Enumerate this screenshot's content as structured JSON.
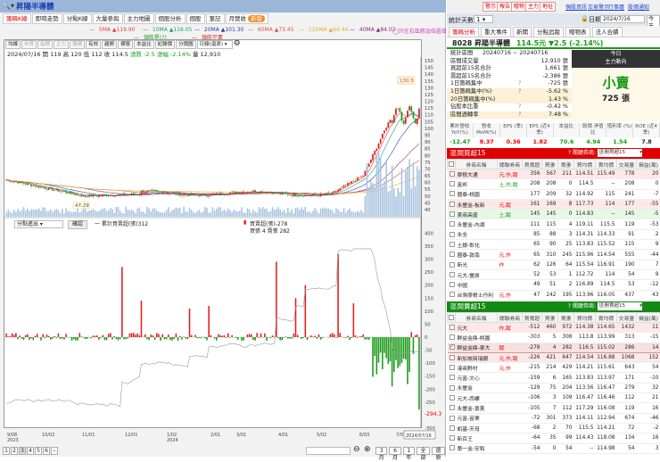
{
  "window": {
    "title": "昇陽半導體",
    "search_icon": "search-icon"
  },
  "tabs": [
    {
      "label": "籌碼K線",
      "active": true
    },
    {
      "label": "即時走勢"
    },
    {
      "label": "分點K線"
    },
    {
      "label": "大量參與"
    },
    {
      "label": "主力地圖"
    },
    {
      "label": "個股分析"
    },
    {
      "label": "個股"
    },
    {
      "label": "筆記"
    },
    {
      "label": "月營收",
      "badge": "新版"
    }
  ],
  "ma_legend": [
    {
      "label": "5MA ▲119.90",
      "color": "#e04040"
    },
    {
      "label": "10MA ▲116.05",
      "color": "#20a080"
    },
    {
      "label": "20MA ▲101.30",
      "color": "#3040a0"
    },
    {
      "label": "60MA ▲73.45",
      "color": "#e05050"
    },
    {
      "label": "120MA ▲64.44",
      "color": "#e0b030"
    },
    {
      "label": "40MA ▲84.02",
      "color": "#803080"
    },
    {
      "label": "領航星(?)",
      "color": "#20a020"
    },
    {
      "label": "領航空軍",
      "color": "#e02020"
    }
  ],
  "ma_note": "◯只在右區將加倍遞增",
  "toolbar": {
    "buttons": [
      {
        "label": "均線",
        "dis": false
      },
      {
        "label": "布買",
        "dis": true
      },
      {
        "label": "指標",
        "dis": true
      },
      {
        "label": "主力",
        "dis": true
      },
      {
        "label": "籌碼",
        "dis": true
      },
      {
        "label": "有效",
        "dis": false
      },
      {
        "label": "趨勢",
        "dis": false
      },
      {
        "label": "標靈",
        "dis": false
      },
      {
        "label": "本益比",
        "dis": false
      },
      {
        "label": "紀錄價",
        "dis": false
      },
      {
        "label": "分價圖",
        "dis": false
      }
    ],
    "period": "日線(還原)"
  },
  "info_line": {
    "date": "2024/07/16",
    "open": "開 119",
    "high": "高 120",
    "low": "低 112",
    "close": "收 114.5",
    "change": "漲跌 -2.5",
    "pct": "漲幅 -2.14%",
    "volume": "量 12,910"
  },
  "price_chart": {
    "y_ticks": [
      150,
      145,
      140,
      135,
      130,
      125,
      120,
      115,
      110,
      105,
      100,
      95,
      90,
      85,
      80,
      75,
      70,
      65,
      60,
      55,
      50,
      45,
      40
    ],
    "max_label": "130.5",
    "min_label": "47.29"
  },
  "lower_panel": {
    "select": "分點進出",
    "confirm": "確認",
    "cum_label": "一 累計買賣超(張)312",
    "net_label": "買賣超(張)-278",
    "buysell_label": "買張 4 賣張 282",
    "y_ticks": [
      400,
      350,
      300,
      250,
      200,
      150,
      100,
      50,
      0,
      -50,
      -100,
      -150,
      -200,
      -250,
      -350
    ],
    "last_value": "-294.3"
  },
  "x_axis": [
    {
      "label": "9/08",
      "sub": "2023"
    },
    {
      "label": "10/02"
    },
    {
      "label": "11/01"
    },
    {
      "label": "12/01"
    },
    {
      "label": "1/02",
      "sub": "2024"
    },
    {
      "label": "2/01"
    },
    {
      "label": "3/01"
    },
    {
      "label": "4/01"
    },
    {
      "label": "5/02"
    },
    {
      "label": "6/03"
    },
    {
      "label": "7/01"
    }
  ],
  "x_current": "2024/07/16",
  "pager": [
    "1",
    "2",
    "3",
    "4",
    "5",
    "6"
  ],
  "range_buttons": [
    "3月",
    "6月",
    "1年",
    "全部",
    "還原"
  ],
  "right": {
    "buttons": [
      "警示",
      "報告",
      "贈物",
      "主力",
      "地址"
    ],
    "links": [
      "個股資訊",
      "交易警示",
      "行事曆",
      "股價通知"
    ],
    "days_label": "統計天數",
    "days_value": "1",
    "date_label": "日期",
    "date_value": "2024/7/16",
    "today": "今天",
    "tabs": [
      "籌碼分析",
      "重大事件",
      "新聞",
      "分點追蹤",
      "贈物表",
      "法人合績"
    ],
    "stock": {
      "code": "8028 昇陽半導體",
      "price": "114.5元",
      "change": "▼2.5 (-2.14%)"
    },
    "stats": [
      {
        "k": "統計區間",
        "v": "20240716 ~ 20240716",
        "y": false
      },
      {
        "k": "區間成交量",
        "v": "12,910 張"
      },
      {
        "k": "買超前15名合計",
        "v": "1,661 張"
      },
      {
        "k": "賣超前15名合計",
        "v": "-2,386 張"
      },
      {
        "k": "1日籌碼集中",
        "v": "-725 張",
        "q": "?"
      },
      {
        "k": "1日籌碼集中(%)",
        "v": "-5.62 %",
        "q": "?",
        "y": true
      },
      {
        "k": "20日籌碼集中(%)",
        "v": "1.43 %",
        "y": true
      },
      {
        "k": "佔股本比重",
        "v": "-0.42 %",
        "q": "?"
      },
      {
        "k": "區間週轉率",
        "v": "7.48 %",
        "q": "?",
        "y": true
      }
    ],
    "today_label": "今日",
    "trend_label": "主力動向",
    "signal": "小賣",
    "signal_qty": "725 張",
    "metrics": [
      {
        "h": "累計營收 YoY(%)",
        "v": "-12.47",
        "c": "#1a9a1a"
      },
      {
        "h": "營收 MoM(%)",
        "v": "8.37",
        "c": "#e00"
      },
      {
        "h": "EPS (季)",
        "v": "0.36",
        "c": "#e00"
      },
      {
        "h": "EPS (近4季)",
        "v": "1.82",
        "c": "#e00"
      },
      {
        "h": "本益比",
        "v": "70.6",
        "c": "#1a9a1a"
      },
      {
        "h": "股價 淨值比",
        "v": "4.94",
        "c": "#1a9a1a"
      },
      {
        "h": "殖利率 (%)",
        "v": "1.54",
        "c": "#1a9a1a"
      },
      {
        "h": "ROE (近4季)",
        "v": "7.8",
        "c": "#222"
      }
    ]
  },
  "columns": [
    "",
    "券商名稱",
    "關聯券商",
    "買賣超",
    "買張",
    "賣張",
    "買均價",
    "賣均價",
    "交易量",
    "損益(萬)"
  ],
  "buy_table": {
    "title": "區間買超15",
    "key_label": "?  關鍵券商:",
    "select": "區間買超15",
    "color": "#e00000",
    "rows": [
      [
        "摩根大通",
        "元,作,蹤",
        "356",
        "567",
        "211",
        "114.51",
        "115.49",
        "778",
        "20",
        "pink"
      ],
      [
        "富邦",
        "土,作,蹤",
        "208",
        "208",
        "0",
        "114.5",
        "--",
        "208",
        "0",
        ""
      ],
      [
        "國泰-桃園",
        "",
        "177",
        "209",
        "32",
        "114.92",
        "115",
        "241",
        "-7",
        ""
      ],
      [
        "永豐金-板新",
        "元,蹤",
        "161",
        "169",
        "8",
        "117.73",
        "114",
        "177",
        "-55",
        "pink"
      ],
      [
        "美商高盛",
        "土,蹤",
        "145",
        "145",
        "0",
        "114.83",
        "--",
        "145",
        "-5",
        "green"
      ],
      [
        "永豐金-內湖",
        "",
        "111",
        "115",
        "4",
        "119.11",
        "115.5",
        "119",
        "-53",
        ""
      ],
      [
        "永全",
        "",
        "85",
        "88",
        "3",
        "114.31",
        "114.33",
        "91",
        "2",
        ""
      ],
      [
        "土銀-彰化",
        "",
        "65",
        "90",
        "25",
        "113.83",
        "115.52",
        "115",
        "9",
        ""
      ],
      [
        "國泰-敦南",
        "元,作",
        "65",
        "310",
        "245",
        "115.96",
        "114.54",
        "555",
        "-44",
        ""
      ],
      [
        "新光",
        "作",
        "62",
        "126",
        "64",
        "115.54",
        "116.91",
        "190",
        "7",
        ""
      ],
      [
        "元大-豐原",
        "",
        "52",
        "53",
        "1",
        "112.72",
        "114",
        "54",
        "9",
        ""
      ],
      [
        "中國",
        "",
        "49",
        "51",
        "2",
        "116.89",
        "114.5",
        "53",
        "-12",
        ""
      ],
      [
        "台灣摩根士丹利",
        "元,作",
        "47",
        "242",
        "195",
        "113.96",
        "116.05",
        "437",
        "43",
        ""
      ]
    ]
  },
  "sell_table": {
    "title": "區間賣超15",
    "key_label": "?  關鍵券商:",
    "select": "區間賣超15",
    "color": "#138a13",
    "rows": [
      [
        "元大",
        "作,蹤",
        "-512",
        "460",
        "972",
        "114.38",
        "114.65",
        "1432",
        "11",
        "pink"
      ],
      [
        "群益金鼎-桃園",
        "",
        "-303",
        "5",
        "308",
        "113.8",
        "113.99",
        "313",
        "-15",
        ""
      ],
      [
        "群益金鼎-東大",
        "蹤",
        "-278",
        "4",
        "282",
        "116.5",
        "115.02",
        "286",
        "14",
        "sel"
      ],
      [
        "新加坡商瑞銀",
        "元,作,蹤",
        "-226",
        "421",
        "647",
        "114.54",
        "116.88",
        "1068",
        "152",
        "pink"
      ],
      [
        "港商野村",
        "元,作",
        "-215",
        "214",
        "429",
        "114.21",
        "115.61",
        "643",
        "54",
        ""
      ],
      [
        "元富-文心",
        "",
        "-159",
        "6",
        "165",
        "113.83",
        "113.97",
        "171",
        "-10",
        ""
      ],
      [
        "永豐金",
        "",
        "-129",
        "75",
        "204",
        "113.56",
        "116.47",
        "279",
        "32",
        ""
      ],
      [
        "元大-西螺",
        "",
        "-106",
        "3",
        "109",
        "116.47",
        "116.46",
        "112",
        "21",
        ""
      ],
      [
        "永豐金-景美",
        "",
        "-105",
        "7",
        "112",
        "117.29",
        "116.08",
        "119",
        "16",
        ""
      ],
      [
        "元富-苗栗",
        "",
        "-72",
        "301",
        "373",
        "114.11",
        "112.94",
        "674",
        "-46",
        ""
      ],
      [
        "凱基-天母",
        "",
        "-68",
        "2",
        "70",
        "115.5",
        "114.21",
        "72",
        "-2",
        ""
      ],
      [
        "新百王",
        "",
        "-64",
        "35",
        "99",
        "114.43",
        "118.08",
        "134",
        "16",
        ""
      ],
      [
        "第一金-安和",
        "",
        "-54",
        "0",
        "54",
        "--",
        "114.98",
        "54",
        "3",
        ""
      ]
    ]
  }
}
